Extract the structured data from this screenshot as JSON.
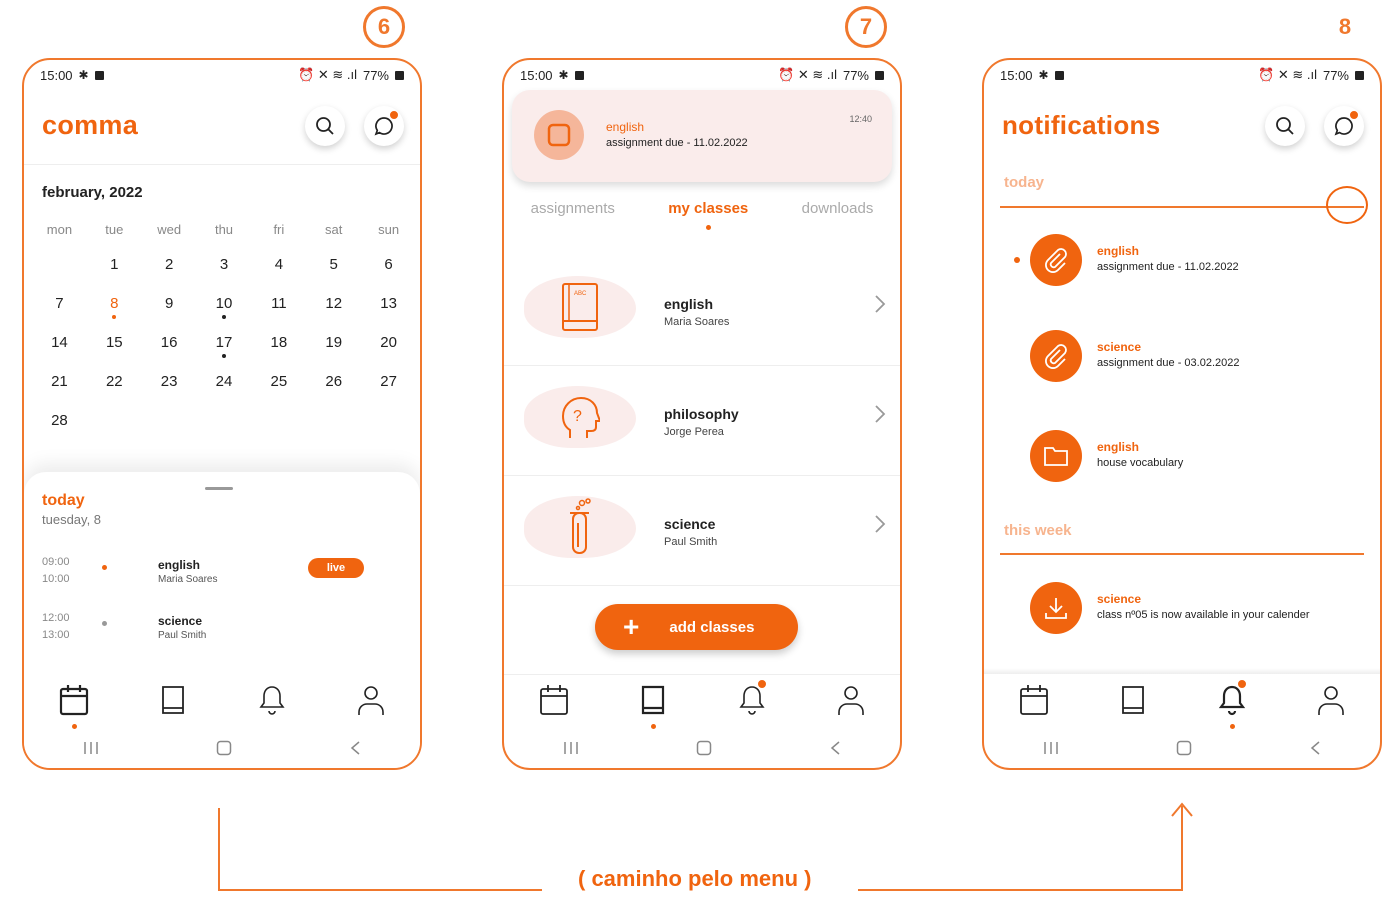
{
  "steps": [
    "6",
    "7",
    "8"
  ],
  "status": {
    "time": "15:00",
    "battery": "77%"
  },
  "phone1": {
    "app_name": "comma",
    "month": "february, 2022",
    "weekdays": [
      "mon",
      "tue",
      "wed",
      "thu",
      "fri",
      "sat",
      "sun"
    ],
    "weeks": [
      [
        "",
        "1",
        "2",
        "3",
        "4",
        "5",
        "6"
      ],
      [
        "7",
        "8",
        "9",
        "10",
        "11",
        "12",
        "13"
      ],
      [
        "14",
        "15",
        "16",
        "17",
        "18",
        "19",
        "20"
      ],
      [
        "21",
        "22",
        "23",
        "24",
        "25",
        "26",
        "27"
      ],
      [
        "28",
        "",
        "",
        "",
        "",
        "",
        ""
      ]
    ],
    "today_title": "today",
    "today_sub": "tuesday, 8",
    "events": [
      {
        "start": "09:00",
        "end": "10:00",
        "subject": "english",
        "teacher": "Maria Soares",
        "badge": "live"
      },
      {
        "start": "12:00",
        "end": "13:00",
        "subject": "science",
        "teacher": "Paul Smith",
        "badge": ""
      }
    ]
  },
  "phone2": {
    "notification": {
      "subject": "english",
      "desc": "assignment due - 11.02.2022",
      "time": "12:40"
    },
    "tabs": [
      "assignments",
      "my classes",
      "downloads"
    ],
    "classes": [
      {
        "name": "english",
        "teacher": "Maria Soares",
        "icon": "book-icon"
      },
      {
        "name": "philosophy",
        "teacher": "Jorge Perea",
        "icon": "head-question-icon"
      },
      {
        "name": "science",
        "teacher": "Paul Smith",
        "icon": "test-tube-icon"
      }
    ],
    "add_label": "add classes"
  },
  "phone3": {
    "title": "notifications",
    "section_today": "today",
    "section_week": "this week",
    "items": [
      {
        "subject": "english",
        "desc": "assignment due - 11.02.2022",
        "icon": "paperclip-icon"
      },
      {
        "subject": "science",
        "desc": "assignment due - 03.02.2022",
        "icon": "paperclip-icon"
      },
      {
        "subject": "english",
        "desc": "house vocabulary",
        "icon": "folder-icon"
      },
      {
        "subject": "science",
        "desc": "class nº05 is now available in your calender",
        "icon": "download-icon"
      }
    ]
  },
  "flow_label": "( caminho pelo menu )",
  "colors": {
    "accent": "#f0640f",
    "accent_light": "#faeceb"
  }
}
